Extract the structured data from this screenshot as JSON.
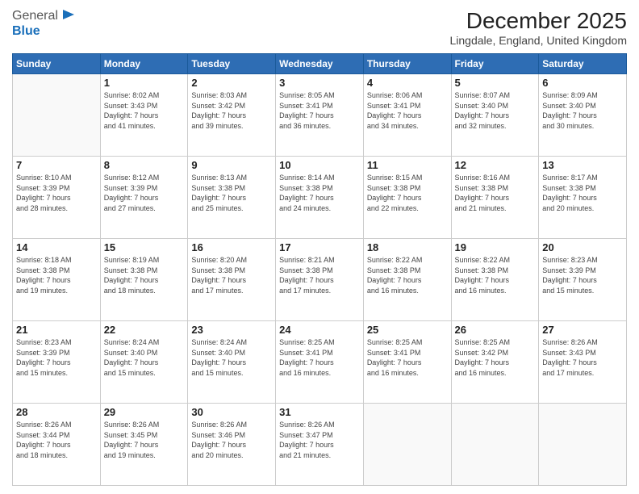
{
  "header": {
    "logo_line1": "General",
    "logo_line2": "Blue",
    "main_title": "December 2025",
    "subtitle": "Lingdale, England, United Kingdom"
  },
  "calendar": {
    "days_of_week": [
      "Sunday",
      "Monday",
      "Tuesday",
      "Wednesday",
      "Thursday",
      "Friday",
      "Saturday"
    ],
    "weeks": [
      [
        {
          "day": "",
          "info": ""
        },
        {
          "day": "1",
          "info": "Sunrise: 8:02 AM\nSunset: 3:43 PM\nDaylight: 7 hours\nand 41 minutes."
        },
        {
          "day": "2",
          "info": "Sunrise: 8:03 AM\nSunset: 3:42 PM\nDaylight: 7 hours\nand 39 minutes."
        },
        {
          "day": "3",
          "info": "Sunrise: 8:05 AM\nSunset: 3:41 PM\nDaylight: 7 hours\nand 36 minutes."
        },
        {
          "day": "4",
          "info": "Sunrise: 8:06 AM\nSunset: 3:41 PM\nDaylight: 7 hours\nand 34 minutes."
        },
        {
          "day": "5",
          "info": "Sunrise: 8:07 AM\nSunset: 3:40 PM\nDaylight: 7 hours\nand 32 minutes."
        },
        {
          "day": "6",
          "info": "Sunrise: 8:09 AM\nSunset: 3:40 PM\nDaylight: 7 hours\nand 30 minutes."
        }
      ],
      [
        {
          "day": "7",
          "info": "Sunrise: 8:10 AM\nSunset: 3:39 PM\nDaylight: 7 hours\nand 28 minutes."
        },
        {
          "day": "8",
          "info": "Sunrise: 8:12 AM\nSunset: 3:39 PM\nDaylight: 7 hours\nand 27 minutes."
        },
        {
          "day": "9",
          "info": "Sunrise: 8:13 AM\nSunset: 3:38 PM\nDaylight: 7 hours\nand 25 minutes."
        },
        {
          "day": "10",
          "info": "Sunrise: 8:14 AM\nSunset: 3:38 PM\nDaylight: 7 hours\nand 24 minutes."
        },
        {
          "day": "11",
          "info": "Sunrise: 8:15 AM\nSunset: 3:38 PM\nDaylight: 7 hours\nand 22 minutes."
        },
        {
          "day": "12",
          "info": "Sunrise: 8:16 AM\nSunset: 3:38 PM\nDaylight: 7 hours\nand 21 minutes."
        },
        {
          "day": "13",
          "info": "Sunrise: 8:17 AM\nSunset: 3:38 PM\nDaylight: 7 hours\nand 20 minutes."
        }
      ],
      [
        {
          "day": "14",
          "info": "Sunrise: 8:18 AM\nSunset: 3:38 PM\nDaylight: 7 hours\nand 19 minutes."
        },
        {
          "day": "15",
          "info": "Sunrise: 8:19 AM\nSunset: 3:38 PM\nDaylight: 7 hours\nand 18 minutes."
        },
        {
          "day": "16",
          "info": "Sunrise: 8:20 AM\nSunset: 3:38 PM\nDaylight: 7 hours\nand 17 minutes."
        },
        {
          "day": "17",
          "info": "Sunrise: 8:21 AM\nSunset: 3:38 PM\nDaylight: 7 hours\nand 17 minutes."
        },
        {
          "day": "18",
          "info": "Sunrise: 8:22 AM\nSunset: 3:38 PM\nDaylight: 7 hours\nand 16 minutes."
        },
        {
          "day": "19",
          "info": "Sunrise: 8:22 AM\nSunset: 3:38 PM\nDaylight: 7 hours\nand 16 minutes."
        },
        {
          "day": "20",
          "info": "Sunrise: 8:23 AM\nSunset: 3:39 PM\nDaylight: 7 hours\nand 15 minutes."
        }
      ],
      [
        {
          "day": "21",
          "info": "Sunrise: 8:23 AM\nSunset: 3:39 PM\nDaylight: 7 hours\nand 15 minutes."
        },
        {
          "day": "22",
          "info": "Sunrise: 8:24 AM\nSunset: 3:40 PM\nDaylight: 7 hours\nand 15 minutes."
        },
        {
          "day": "23",
          "info": "Sunrise: 8:24 AM\nSunset: 3:40 PM\nDaylight: 7 hours\nand 15 minutes."
        },
        {
          "day": "24",
          "info": "Sunrise: 8:25 AM\nSunset: 3:41 PM\nDaylight: 7 hours\nand 16 minutes."
        },
        {
          "day": "25",
          "info": "Sunrise: 8:25 AM\nSunset: 3:41 PM\nDaylight: 7 hours\nand 16 minutes."
        },
        {
          "day": "26",
          "info": "Sunrise: 8:25 AM\nSunset: 3:42 PM\nDaylight: 7 hours\nand 16 minutes."
        },
        {
          "day": "27",
          "info": "Sunrise: 8:26 AM\nSunset: 3:43 PM\nDaylight: 7 hours\nand 17 minutes."
        }
      ],
      [
        {
          "day": "28",
          "info": "Sunrise: 8:26 AM\nSunset: 3:44 PM\nDaylight: 7 hours\nand 18 minutes."
        },
        {
          "day": "29",
          "info": "Sunrise: 8:26 AM\nSunset: 3:45 PM\nDaylight: 7 hours\nand 19 minutes."
        },
        {
          "day": "30",
          "info": "Sunrise: 8:26 AM\nSunset: 3:46 PM\nDaylight: 7 hours\nand 20 minutes."
        },
        {
          "day": "31",
          "info": "Sunrise: 8:26 AM\nSunset: 3:47 PM\nDaylight: 7 hours\nand 21 minutes."
        },
        {
          "day": "",
          "info": ""
        },
        {
          "day": "",
          "info": ""
        },
        {
          "day": "",
          "info": ""
        }
      ]
    ]
  }
}
